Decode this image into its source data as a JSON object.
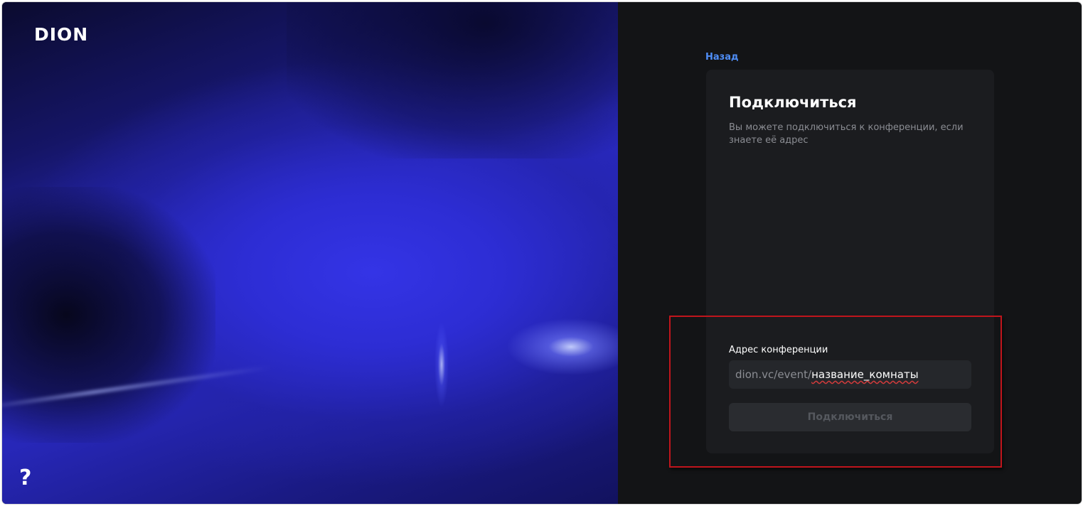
{
  "app": {
    "logo": "DION",
    "help_label": "?"
  },
  "nav": {
    "back_label": "Назад"
  },
  "connect_card": {
    "title": "Подключиться",
    "description": "Вы можете подключиться к конференции, если знаете её адрес",
    "address_label": "Адрес конференции",
    "address_prefix": "dion.vc/event/",
    "address_value": "название_комнаты",
    "connect_button_label": "Подключиться"
  },
  "colors": {
    "accent_link": "#4f8ef7",
    "panel_background": "#131416",
    "card_background": "#1b1c1f",
    "highlight_border": "#c0151c",
    "hero_blue": "#2d2dd4"
  }
}
